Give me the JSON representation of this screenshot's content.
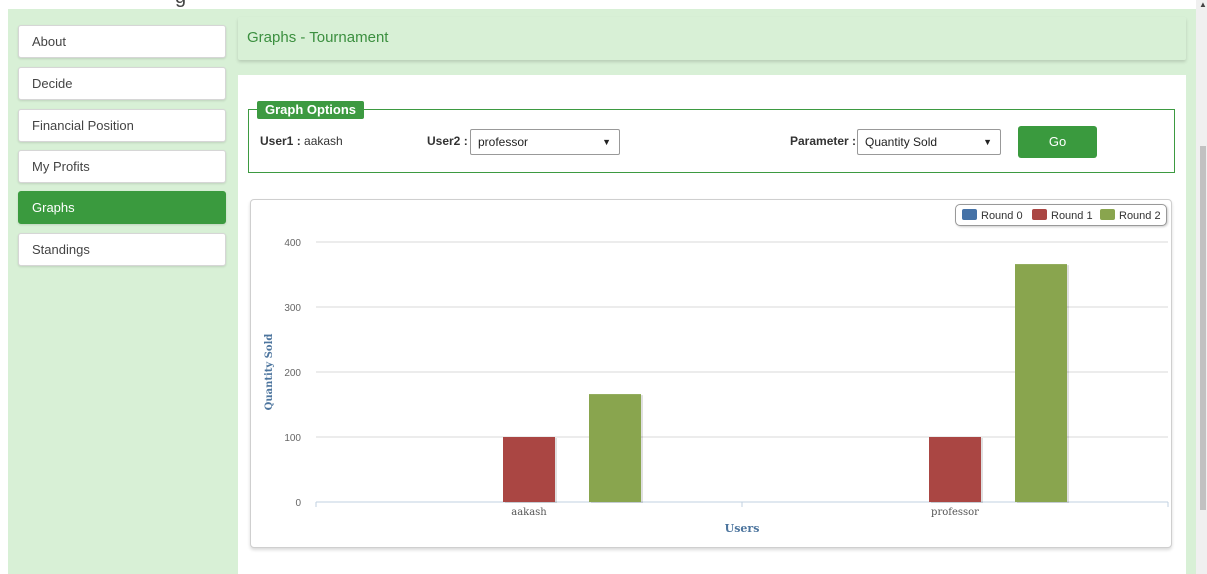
{
  "top_text": "g",
  "sidebar": {
    "items": [
      {
        "label": "About",
        "active": false
      },
      {
        "label": "Decide",
        "active": false
      },
      {
        "label": "Financial Position",
        "active": false
      },
      {
        "label": "My Profits",
        "active": false
      },
      {
        "label": "Graphs",
        "active": true
      },
      {
        "label": "Standings",
        "active": false
      }
    ]
  },
  "header": {
    "title": "Graphs - Tournament"
  },
  "options": {
    "legend": "Graph Options",
    "user1_label": "User1 :",
    "user1_value": "aakash",
    "user2_label": "User2 :",
    "user2_value": "professor",
    "parameter_label": "Parameter :",
    "parameter_value": "Quantity Sold",
    "go_label": "Go"
  },
  "chart_data": {
    "type": "bar",
    "categories": [
      "aakash",
      "professor"
    ],
    "series": [
      {
        "name": "Round 0",
        "values": [
          0,
          0
        ],
        "color": "#4572a7"
      },
      {
        "name": "Round 1",
        "values": [
          100,
          100
        ],
        "color": "#aa4643"
      },
      {
        "name": "Round 2",
        "values": [
          166,
          366
        ],
        "color": "#89a54e"
      }
    ],
    "xlabel": "Users",
    "ylabel": "Quantity Sold",
    "yticks": [
      "0",
      "100",
      "200",
      "300",
      "400"
    ],
    "ylim": [
      0,
      400
    ],
    "grid": true,
    "legend_position": "top-right"
  }
}
